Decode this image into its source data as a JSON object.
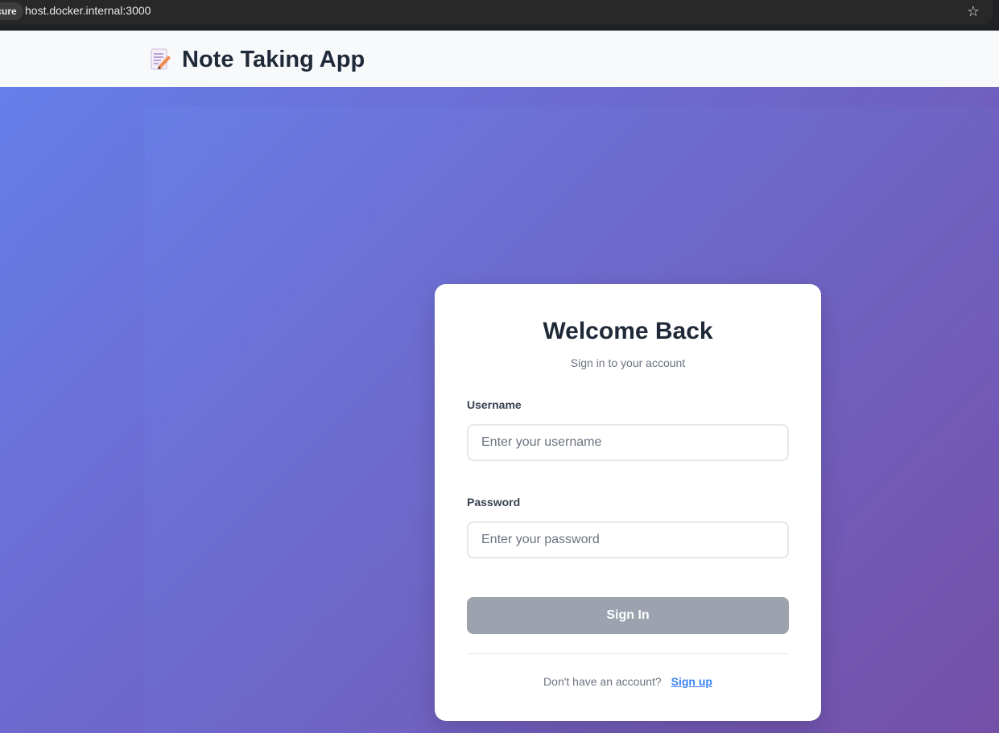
{
  "browser": {
    "security_label": "secure",
    "url": "host.docker.internal:3000",
    "bookmark_icon": "star-icon"
  },
  "header": {
    "logo_icon": "memo-icon",
    "title": "Note Taking App"
  },
  "login": {
    "title": "Welcome Back",
    "subtitle": "Sign in to your account",
    "username_label": "Username",
    "username_placeholder": "Enter your username",
    "username_value": "",
    "password_label": "Password",
    "password_placeholder": "Enter your password",
    "password_value": "",
    "signin_label": "Sign In",
    "signup_prompt": "Don't have an account?",
    "signup_link": "Sign up"
  },
  "colors": {
    "gradient_start": "#667eea",
    "gradient_end": "#764ba2",
    "button_disabled": "#9ca3af",
    "link": "#3b82f6"
  }
}
